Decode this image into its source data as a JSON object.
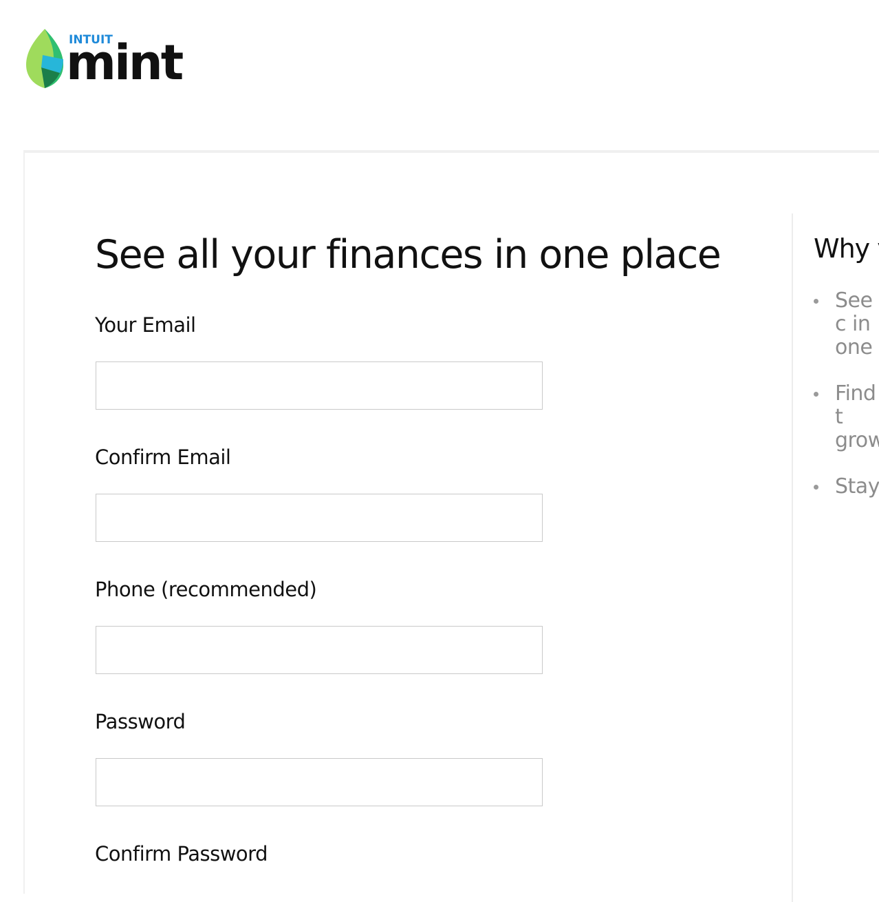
{
  "header": {
    "logo_sub": "INTUIT",
    "logo_main": "mint",
    "leaf_colors": [
      "#9fdb5c",
      "#2fbf71",
      "#27b6d9",
      "#1b7e4a"
    ]
  },
  "form": {
    "title": "See all your finances in one place",
    "fields": [
      {
        "label": "Your Email",
        "value": "",
        "placeholder": ""
      },
      {
        "label": "Confirm Email",
        "value": "",
        "placeholder": ""
      },
      {
        "label": "Phone (recommended)",
        "value": "",
        "placeholder": ""
      },
      {
        "label": "Password",
        "value": "",
        "placeholder": ""
      },
      {
        "label": "Confirm Password"
      }
    ]
  },
  "why": {
    "title": "Why y",
    "items": [
      {
        "text": "See c in one"
      },
      {
        "text": "Find t grow"
      },
      {
        "text": "Stay ."
      }
    ]
  }
}
